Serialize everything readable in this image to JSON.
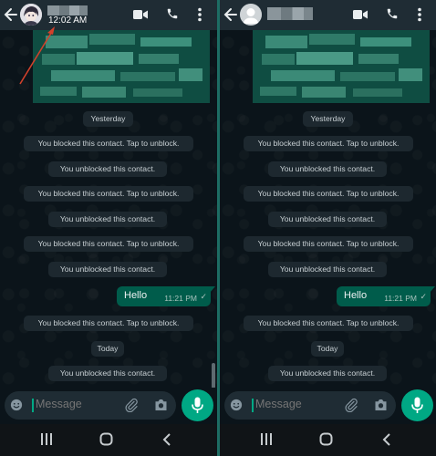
{
  "left": {
    "header": {
      "last_seen": "12:02 AM"
    },
    "chat": {
      "date_yesterday": "Yesterday",
      "date_today": "Today",
      "sys1": "You blocked this contact. Tap to unblock.",
      "sys2": "You unblocked this contact.",
      "sys3": "You blocked this contact. Tap to unblock.",
      "sys4": "You unblocked this contact.",
      "sys5": "You blocked this contact. Tap to unblock.",
      "sys6": "You unblocked this contact.",
      "sys7": "You blocked this contact. Tap to unblock.",
      "sys8": "You unblocked this contact.",
      "out_text": "Hello",
      "out_time": "11:21 PM",
      "out_tick": "✓"
    },
    "input": {
      "placeholder": "Message"
    }
  },
  "right": {
    "chat": {
      "date_yesterday": "Yesterday",
      "date_today": "Today",
      "sys1": "You blocked this contact. Tap to unblock.",
      "sys2": "You unblocked this contact.",
      "sys3": "You blocked this contact. Tap to unblock.",
      "sys4": "You unblocked this contact.",
      "sys5": "You blocked this contact. Tap to unblock.",
      "sys6": "You unblocked this contact.",
      "sys7": "You blocked this contact. Tap to unblock.",
      "sys8": "You unblocked this contact.",
      "out_text": "Hello",
      "out_time": "11:21 PM",
      "out_tick": "✓"
    },
    "input": {
      "placeholder": "Message"
    }
  },
  "colors": {
    "header_bg": "#1f2c34",
    "chat_bg": "#0b141a",
    "system_bubble": "#1d282f",
    "outgoing_bubble": "#005c4b",
    "accent": "#00a884",
    "divider": "#1d6d64",
    "annotation_arrow": "#d2412b"
  },
  "icons": {
    "header": [
      "back-arrow-icon",
      "avatar",
      "video-call-icon",
      "phone-icon",
      "more-vert-icon"
    ],
    "input": [
      "emoji-icon",
      "attach-icon",
      "camera-icon",
      "mic-icon"
    ],
    "nav": [
      "recents-icon",
      "home-icon",
      "back-icon"
    ]
  }
}
